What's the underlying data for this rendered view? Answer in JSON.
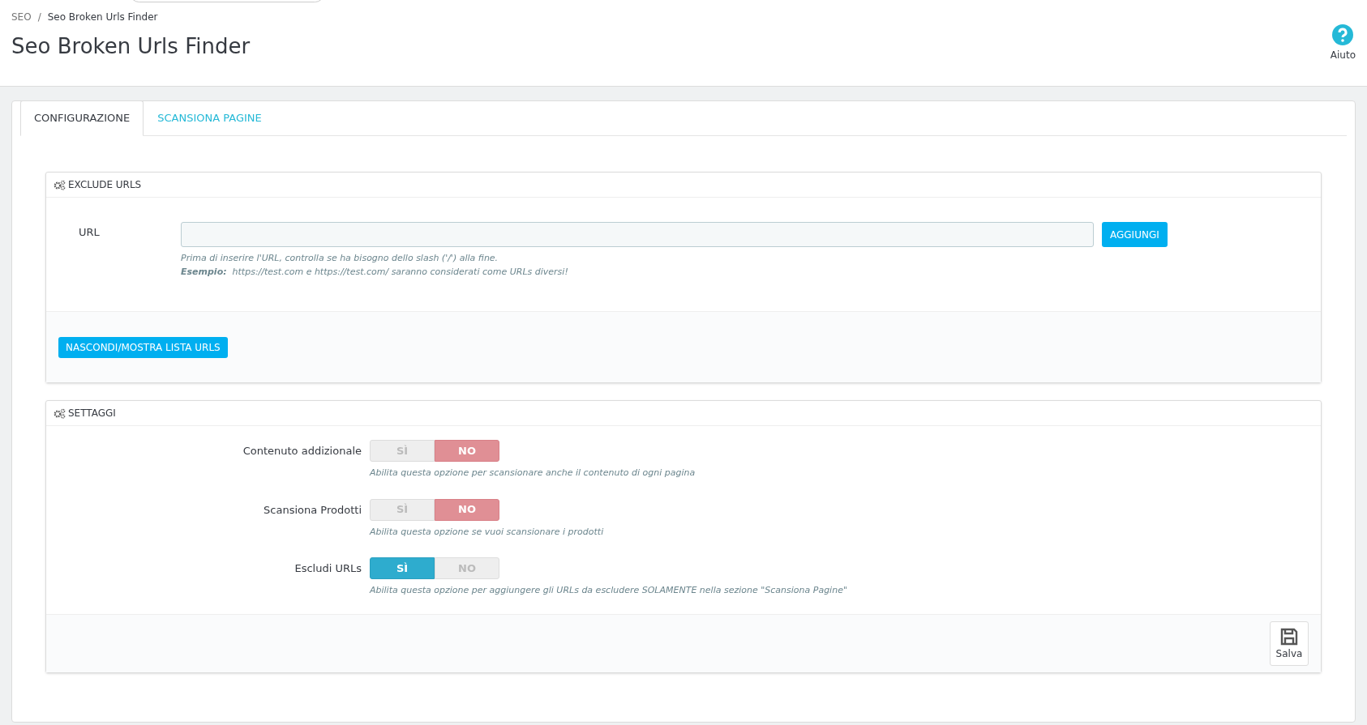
{
  "breadcrumb": {
    "items": [
      "SEO",
      "Seo Broken Urls Finder"
    ],
    "separator": "/"
  },
  "page_title": "Seo Broken Urls Finder",
  "help": {
    "label": "Aiuto"
  },
  "tabs": [
    {
      "label": "CONFIGURAZIONE",
      "selected": true
    },
    {
      "label": "SCANSIONA PAGINE",
      "selected": false
    }
  ],
  "exclude_panel": {
    "title": "EXCLUDE URLS",
    "field_label": "URL",
    "add_button": "AGGIUNGI",
    "hint": "Prima di inserire l'URL, controlla se ha bisogno dello slash ('/') alla fine.",
    "example": "**Esempio:**  https://test.com e https://test.com/ saranno considerati come URLs diversi!",
    "toggle_button": "NASCONDI/MOSTRA LISTA URLS"
  },
  "settings_panel": {
    "title": "SETTAGGI",
    "save_button": "Salva",
    "rows": [
      {
        "label": "Contenuto addizionale",
        "options": [
          {
            "label": "SÌ",
            "selected": false
          },
          {
            "label": "NO",
            "selected": true
          }
        ],
        "hint": "Abilita questa opzione per scansionare anche il contenuto di ogni pagina"
      },
      {
        "label": "Scansiona Prodotti",
        "options": [
          {
            "label": "SÌ",
            "selected": false
          },
          {
            "label": "NO",
            "selected": true
          }
        ],
        "hint": "Abilita questa opzione se vuoi scansionare i prodotti"
      },
      {
        "label": "Escludi URLs",
        "options": [
          {
            "label": "SÌ",
            "selected": true
          },
          {
            "label": "NO",
            "selected": false
          }
        ],
        "hint": "Abilita questa opzione per aggiungere gli URLs da escludere SOLAMENTE nella sezione \"Scansiona Pagine\""
      }
    ]
  }
}
